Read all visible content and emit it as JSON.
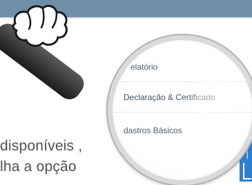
{
  "header": {
    "color": "#6f8fa9"
  },
  "magnifier": {
    "menu_items": [
      {
        "label": "elatório",
        "icon": ""
      },
      {
        "label": "Declaração & Certificado",
        "icon": ""
      },
      {
        "label": "dastros Básicos",
        "icon": ""
      }
    ]
  },
  "page_text": {
    "line1": "disponíveis ,",
    "line2": "lha a opção"
  },
  "icons": {
    "hand": "hand-pointer-icon",
    "magnifier": "magnifier-icon"
  },
  "colors": {
    "accent_blue": "#2f7fd1",
    "text_gray": "#4f4f4f"
  }
}
